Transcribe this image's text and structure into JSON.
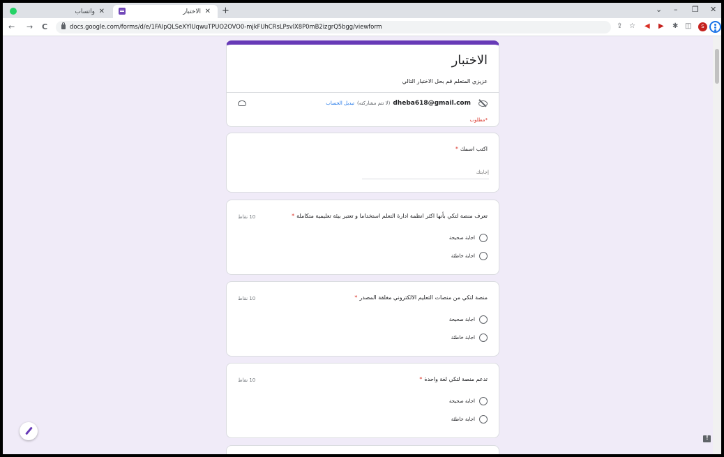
{
  "browser": {
    "tabs": [
      {
        "title": "واتساب",
        "close": "✕"
      },
      {
        "title": "الاختبار",
        "close": "✕"
      }
    ],
    "new_tab": "+",
    "window_controls": {
      "dropdown": "⌄",
      "minimize": "–",
      "restore": "❐",
      "close": "✕"
    },
    "url": "docs.google.com/forms/d/e/1FAIpQLSeXYlUqwuTPUO2OVO0-mjkFUhCRsLPsvlX8P0mB2izgrQ5bgg/viewform",
    "nav": {
      "back": "←",
      "forward": "→",
      "reload": "C"
    },
    "profile_initial": "S"
  },
  "form": {
    "title": "الاختبار",
    "description": "عزيزي المتعلم قم بحل الاختبار التالي",
    "account": {
      "email": "dheba618@gmail.com",
      "not_shared": "(لا تتم مشاركته)",
      "switch_account": "تبديل الحساب"
    },
    "required_note": "*مطلوب",
    "name_question": {
      "label": "اكتب اسمك",
      "required_mark": "*",
      "placeholder": "إجابتك"
    },
    "questions": [
      {
        "text": "تعرف منصة لتكي بأنها اكثر انظمة ادارة التعلم استخداما و تعتبر بيئة تعليمية متكاملة",
        "required_mark": "*",
        "points": "10 نقاط",
        "options": [
          "اجابة صحيحة",
          "اجابة خاطئة"
        ]
      },
      {
        "text": "منصة لتكي من منصات التعليم الالكتروني مغلقة المصدر",
        "required_mark": "*",
        "points": "10 نقاط",
        "options": [
          "اجابة صحيحة",
          "اجابة خاطئة"
        ]
      },
      {
        "text": "تدعم منصة لتكي لغة واحدة",
        "required_mark": "*",
        "points": "10 نقاط",
        "options": [
          "اجابة صحيحة",
          "اجابة خاطئة"
        ]
      }
    ]
  },
  "colors": {
    "accent": "#673ab7",
    "page_bg": "#f0ebf8",
    "required": "#d93025",
    "link": "#1a73e8"
  }
}
